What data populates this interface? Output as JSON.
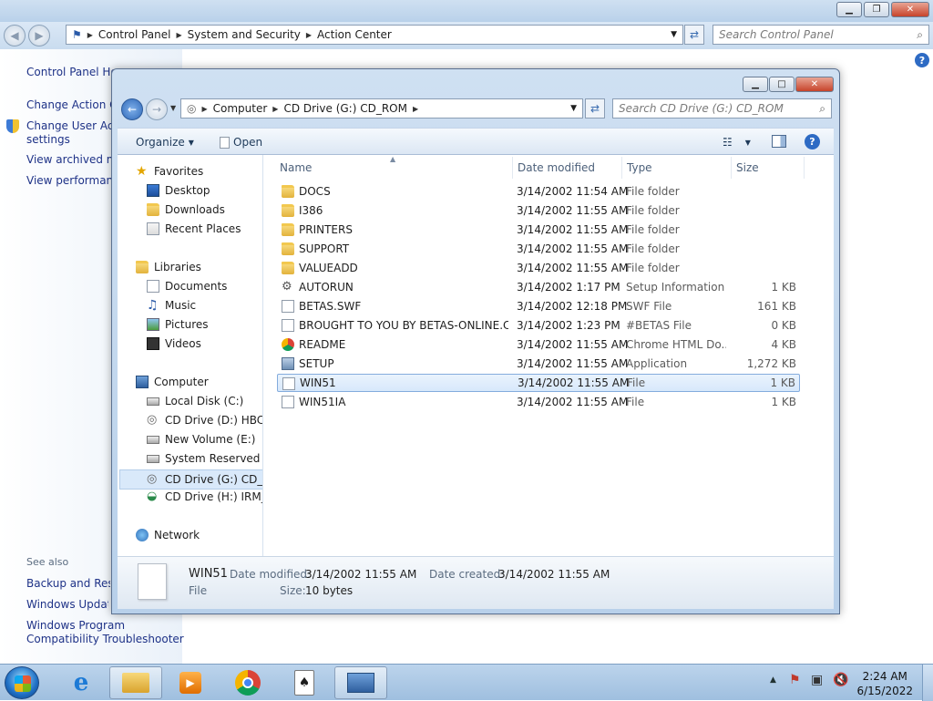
{
  "control_panel": {
    "breadcrumb": [
      "Control Panel",
      "System and Security",
      "Action Center"
    ],
    "search_placeholder": "Search Control Panel",
    "left_links": [
      "Control Panel Home",
      "Change Action Center settings",
      "Change User Account Control",
      "settings",
      "View archived messages",
      "View performance information"
    ],
    "see_also_label": "See also",
    "see_also_links": [
      "Backup and Restore",
      "Windows Update",
      "Windows Program",
      "Compatibility Troubleshooter"
    ],
    "help": "?"
  },
  "explorer": {
    "breadcrumb": [
      "Computer",
      "CD Drive (G:) CD_ROM"
    ],
    "search_placeholder": "Search CD Drive (G:) CD_ROM",
    "toolbar": {
      "organize": "Organize",
      "open": "Open",
      "help": "?"
    },
    "nav": {
      "favorites": "Favorites",
      "favorites_items": [
        "Desktop",
        "Downloads",
        "Recent Places"
      ],
      "libraries": "Libraries",
      "libraries_items": [
        "Documents",
        "Music",
        "Pictures",
        "Videos"
      ],
      "computer": "Computer",
      "computer_items": [
        "Local Disk (C:)",
        "CD Drive (D:) HBCD_",
        "New Volume (E:)",
        "System Reserved (F:)",
        "CD Drive (G:) CD_RO",
        "CD Drive (H:) IRM_SI"
      ],
      "network": "Network"
    },
    "columns": [
      "Name",
      "Date modified",
      "Type",
      "Size"
    ],
    "files": [
      {
        "name": "DOCS",
        "date": "3/14/2002 11:54 AM",
        "type": "File folder",
        "size": "",
        "icon": "folder"
      },
      {
        "name": "I386",
        "date": "3/14/2002 11:55 AM",
        "type": "File folder",
        "size": "",
        "icon": "folder"
      },
      {
        "name": "PRINTERS",
        "date": "3/14/2002 11:55 AM",
        "type": "File folder",
        "size": "",
        "icon": "folder"
      },
      {
        "name": "SUPPORT",
        "date": "3/14/2002 11:55 AM",
        "type": "File folder",
        "size": "",
        "icon": "folder"
      },
      {
        "name": "VALUEADD",
        "date": "3/14/2002 11:55 AM",
        "type": "File folder",
        "size": "",
        "icon": "folder"
      },
      {
        "name": "AUTORUN",
        "date": "3/14/2002 1:17 PM",
        "type": "Setup Information",
        "size": "1 KB",
        "icon": "gear"
      },
      {
        "name": "BETAS.SWF",
        "date": "3/14/2002 12:18 PM",
        "type": "SWF File",
        "size": "161 KB",
        "icon": "doc"
      },
      {
        "name": "BROUGHT TO YOU BY BETAS-ONLINE.C...",
        "date": "3/14/2002 1:23 PM",
        "type": "#BETAS File",
        "size": "0 KB",
        "icon": "doc"
      },
      {
        "name": "README",
        "date": "3/14/2002 11:55 AM",
        "type": "Chrome HTML Do...",
        "size": "4 KB",
        "icon": "chrome"
      },
      {
        "name": "SETUP",
        "date": "3/14/2002 11:55 AM",
        "type": "Application",
        "size": "1,272 KB",
        "icon": "setup"
      },
      {
        "name": "WIN51",
        "date": "3/14/2002 11:55 AM",
        "type": "File",
        "size": "1 KB",
        "icon": "doc"
      },
      {
        "name": "WIN51IA",
        "date": "3/14/2002 11:55 AM",
        "type": "File",
        "size": "1 KB",
        "icon": "doc"
      }
    ],
    "selected_index": 10,
    "details": {
      "name": "WIN51",
      "date_modified_label": "Date modified:",
      "date_modified": "3/14/2002 11:55 AM",
      "date_created_label": "Date created:",
      "date_created": "3/14/2002 11:55 AM",
      "type": "File",
      "size_label": "Size:",
      "size": "10 bytes"
    }
  },
  "taskbar": {
    "time": "2:24 AM",
    "date": "6/15/2022",
    "buttons": [
      "start-orb",
      "internet-explorer",
      "windows-explorer",
      "media-player",
      "chrome",
      "solitaire",
      "control-panel"
    ]
  }
}
